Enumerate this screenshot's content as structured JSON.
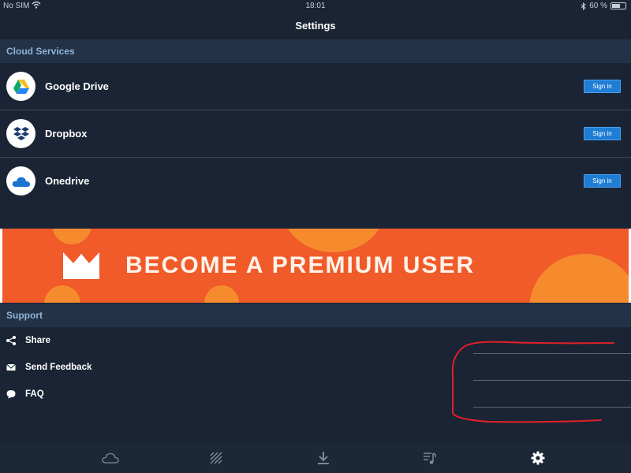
{
  "status_bar": {
    "carrier": "No SIM",
    "time": "18:01",
    "battery": "60 %",
    "battery_level": 0.6
  },
  "nav": {
    "title": "Settings"
  },
  "cloud_section": {
    "header": "Cloud Services",
    "services": [
      {
        "name": "Google Drive",
        "button": "Sign in",
        "icon": "google-drive-icon"
      },
      {
        "name": "Dropbox",
        "button": "Sign in",
        "icon": "dropbox-icon"
      },
      {
        "name": "Onedrive",
        "button": "Sign in",
        "icon": "onedrive-icon"
      }
    ]
  },
  "banner": {
    "text": "BECOME A PREMIUM USER",
    "icon": "crown-icon"
  },
  "support_section": {
    "header": "Support",
    "items": [
      {
        "label": "Share",
        "icon": "share-icon"
      },
      {
        "label": "Send Feedback",
        "icon": "envelope-icon"
      },
      {
        "label": "FAQ",
        "icon": "speech-bubble-icon"
      }
    ]
  },
  "tab_bar": {
    "tabs": [
      {
        "icon": "cloud-icon"
      },
      {
        "icon": "stripes-icon"
      },
      {
        "icon": "download-icon"
      },
      {
        "icon": "playlist-icon"
      },
      {
        "icon": "gear-icon",
        "active": true
      }
    ]
  },
  "colors": {
    "background": "#1a2434",
    "section_header": "#243247",
    "section_header_text": "#8fb3d9",
    "button": "#1f7dd4",
    "banner": "#f15a29",
    "annotation": "#e0202a"
  }
}
